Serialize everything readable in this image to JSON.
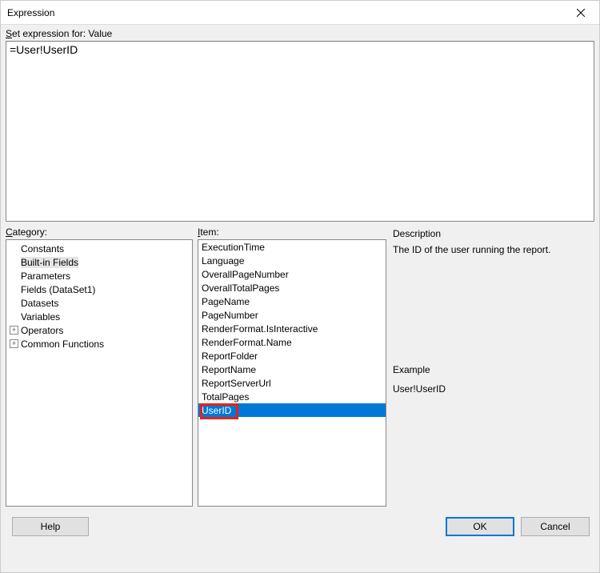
{
  "title": "Expression",
  "expression_label_prefix": "Set expression for: ",
  "expression_target": "Value",
  "expression_value": "=User!UserID",
  "labels": {
    "category": "Category:",
    "item": "Item:",
    "description": "Description",
    "example": "Example",
    "help": "Help",
    "ok": "OK",
    "cancel": "Cancel"
  },
  "categories": [
    {
      "label": "Constants",
      "expandable": false,
      "level": 1
    },
    {
      "label": "Built-in Fields",
      "expandable": false,
      "level": 1,
      "selected": true
    },
    {
      "label": "Parameters",
      "expandable": false,
      "level": 1
    },
    {
      "label": "Fields (DataSet1)",
      "expandable": false,
      "level": 1
    },
    {
      "label": "Datasets",
      "expandable": false,
      "level": 1
    },
    {
      "label": "Variables",
      "expandable": false,
      "level": 1
    },
    {
      "label": "Operators",
      "expandable": true,
      "level": 0
    },
    {
      "label": "Common Functions",
      "expandable": true,
      "level": 0
    }
  ],
  "items": [
    "ExecutionTime",
    "Language",
    "OverallPageNumber",
    "OverallTotalPages",
    "PageName",
    "PageNumber",
    "RenderFormat.IsInteractive",
    "RenderFormat.Name",
    "ReportFolder",
    "ReportName",
    "ReportServerUrl",
    "TotalPages",
    "UserID"
  ],
  "item_selected_index": 12,
  "description_text": "The ID of the user running the report.",
  "example_text": "User!UserID"
}
